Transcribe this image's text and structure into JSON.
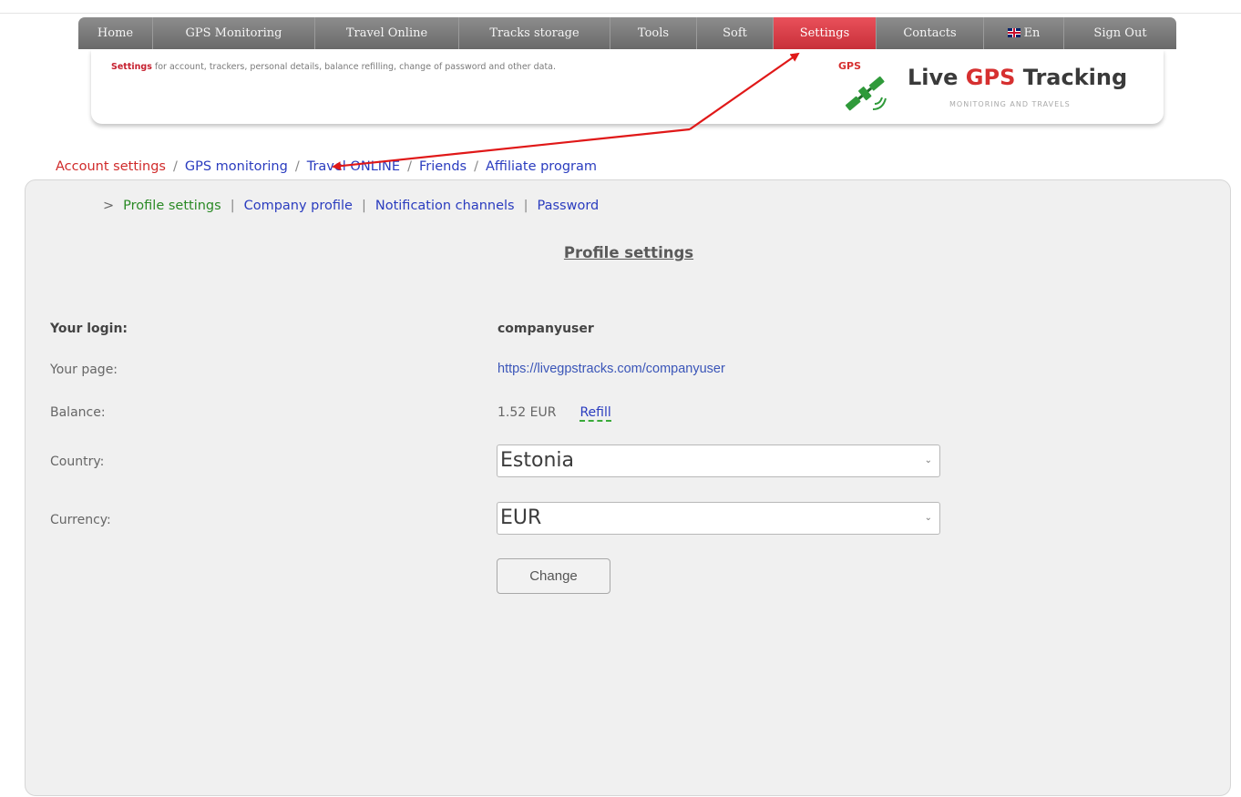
{
  "nav": {
    "items": [
      {
        "label": "Home"
      },
      {
        "label": "GPS Monitoring"
      },
      {
        "label": "Travel Online"
      },
      {
        "label": "Tracks storage"
      },
      {
        "label": "Tools"
      },
      {
        "label": "Soft"
      },
      {
        "label": "Settings",
        "active": true
      },
      {
        "label": "Contacts"
      },
      {
        "label": "En",
        "icon": "uk-flag-icon"
      },
      {
        "label": "Sign Out"
      }
    ]
  },
  "header": {
    "highlight": "Settings",
    "description": " for account, trackers, personal details, balance refilling, change of password and other data.",
    "logo_gps": "GPS",
    "logo_brand_1": "Live ",
    "logo_brand_2": "GPS",
    "logo_brand_3": " Tracking",
    "logo_tagline": "MONITORING AND TRAVELS"
  },
  "breadcrumb": {
    "items": [
      "Account settings",
      "GPS monitoring",
      "Travel ONLINE",
      "Friends",
      "Affiliate program"
    ],
    "separator": "/"
  },
  "subnav": {
    "marker": ">",
    "items": [
      "Profile settings",
      "Company profile",
      "Notification channels",
      "Password"
    ],
    "separator": "|"
  },
  "profile": {
    "title": "Profile settings",
    "login_label": "Your login:",
    "login_value": "companyuser",
    "page_label": "Your page:",
    "page_value": "https://livegpstracks.com/companyuser",
    "balance_label": "Balance:",
    "balance_value": "1.52 EUR",
    "refill_label": "Refill",
    "country_label": "Country:",
    "country_value": "Estonia",
    "currency_label": "Currency:",
    "currency_value": "EUR",
    "change_button": "Change"
  },
  "colors": {
    "active_tab": "#d83a44",
    "annotation_arrow": "#e01818",
    "link": "#2a3cbf",
    "active_subnav": "#2a8a25"
  }
}
